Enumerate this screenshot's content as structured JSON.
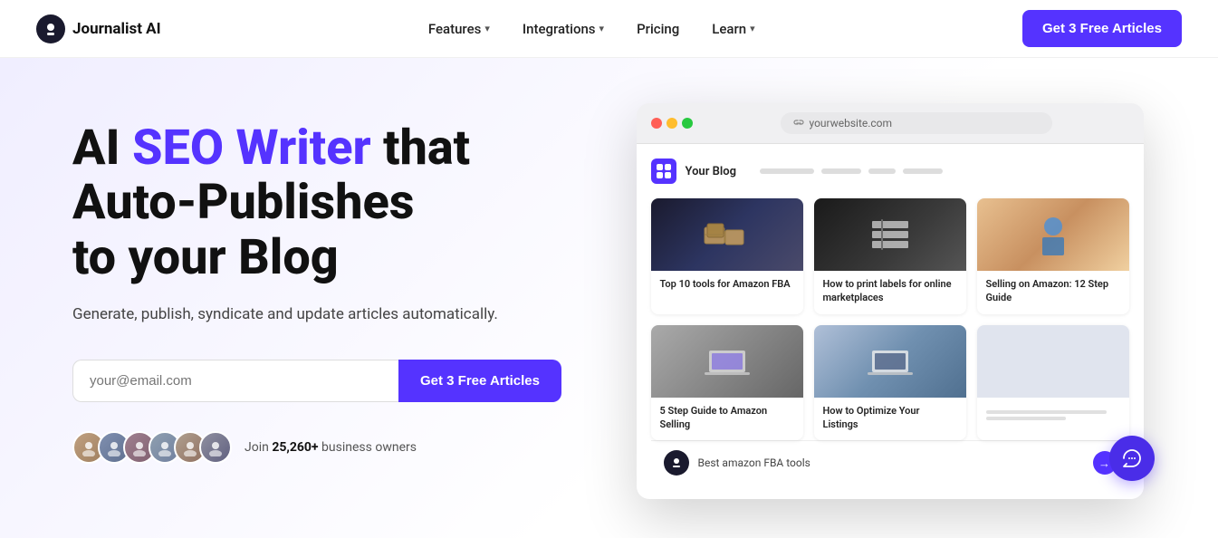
{
  "nav": {
    "logo_text": "Journalist AI",
    "links": [
      {
        "label": "Features",
        "has_dropdown": true
      },
      {
        "label": "Integrations",
        "has_dropdown": true
      },
      {
        "label": "Pricing",
        "has_dropdown": false
      },
      {
        "label": "Learn",
        "has_dropdown": true
      }
    ],
    "cta_label": "Get 3 Free Articles"
  },
  "hero": {
    "title_plain": "AI ",
    "title_highlight": "SEO Writer",
    "title_end": " that Auto-Publishes to your Blog",
    "subtitle": "Generate, publish, syndicate and update articles automatically.",
    "email_placeholder": "your@email.com",
    "cta_label": "Get 3 Free Articles",
    "social_proof": "Join ",
    "social_count": "25,260+",
    "social_suffix": " business owners"
  },
  "browser": {
    "url": "yourwebsite.com",
    "blog_name": "Your Blog",
    "cards": [
      {
        "title": "Top 10 tools for Amazon FBA",
        "img_type": "amazon-boxes"
      },
      {
        "title": "How to print labels for online marketplaces",
        "img_type": "labels"
      },
      {
        "title": "Selling on Amazon: 12 Step Guide",
        "img_type": "delivery"
      },
      {
        "title": "5 Step Guide to Amazon Selling",
        "img_type": "laptop-hands"
      },
      {
        "title": "How to Optimize Your Listings",
        "img_type": "laptop-desk"
      },
      {
        "title": "",
        "img_type": "placeholder"
      }
    ],
    "chat_placeholder": "Best amazon FBA tools"
  },
  "avatars": [
    {
      "color": "#888",
      "initials": ""
    },
    {
      "color": "#666",
      "initials": ""
    },
    {
      "color": "#999",
      "initials": ""
    },
    {
      "color": "#777",
      "initials": ""
    },
    {
      "color": "#555",
      "initials": ""
    },
    {
      "color": "#aaa",
      "initials": ""
    }
  ]
}
